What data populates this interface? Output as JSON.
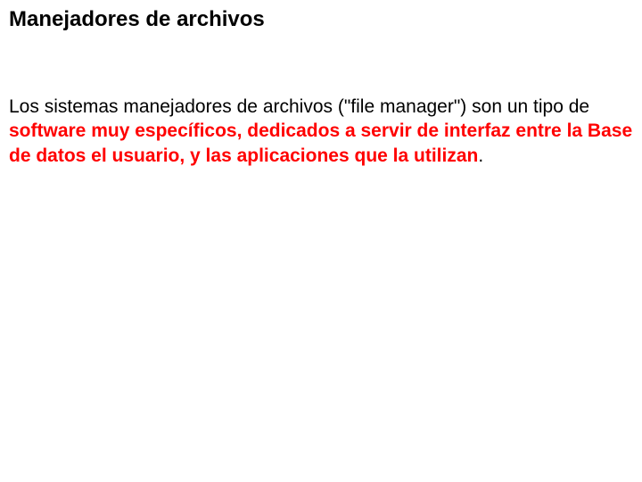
{
  "title": "Manejadores de archivos",
  "paragraph": {
    "intro": "Los sistemas manejadores de archivos (\"file manager\") son un tipo de ",
    "highlight": "software muy específicos, dedicados a servir de interfaz entre la Base de datos el usuario, y las aplicaciones que la utilizan",
    "period": "."
  }
}
